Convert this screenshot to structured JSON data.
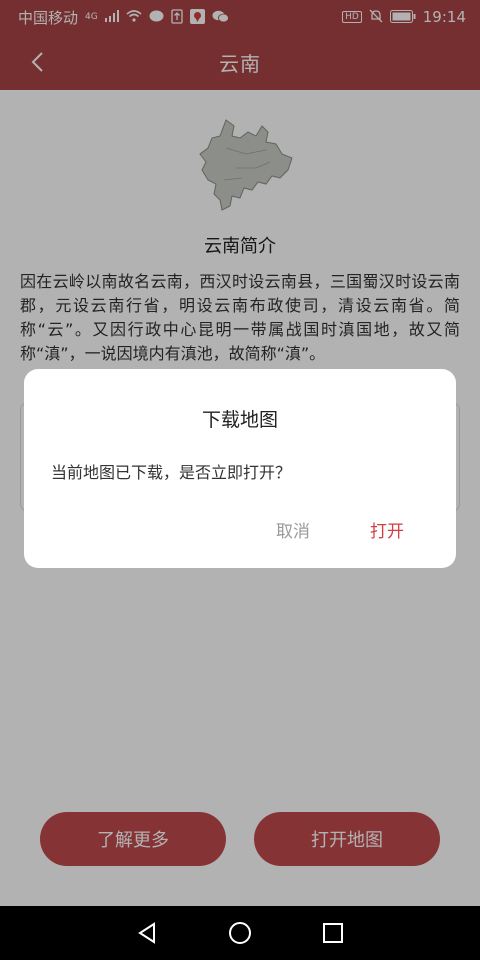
{
  "status_bar": {
    "carrier": "中国移动",
    "network": "4G",
    "hd": "HD",
    "time": "19:14"
  },
  "app_bar": {
    "title": "云南"
  },
  "intro": {
    "title": "云南简介",
    "text": "因在云岭以南故名云南，西汉时设云南县，三国蜀汉时设云南郡，元设云南行省，明设云南布政使司，清设云南省。简称“云”。又因行政中心昆明一带属战国时滇国地，故又简称“滇”，一说因境内有滇池，故简称“滇”。"
  },
  "buttons": {
    "learn_more": "了解更多",
    "open_map": "打开地图"
  },
  "dialog": {
    "title": "下载地图",
    "message": "当前地图已下载，是否立即打开？",
    "cancel": "取消",
    "confirm": "打开"
  },
  "colors": {
    "brand": "#a84446",
    "accent": "#d23e42",
    "button": "#c04a4e"
  }
}
